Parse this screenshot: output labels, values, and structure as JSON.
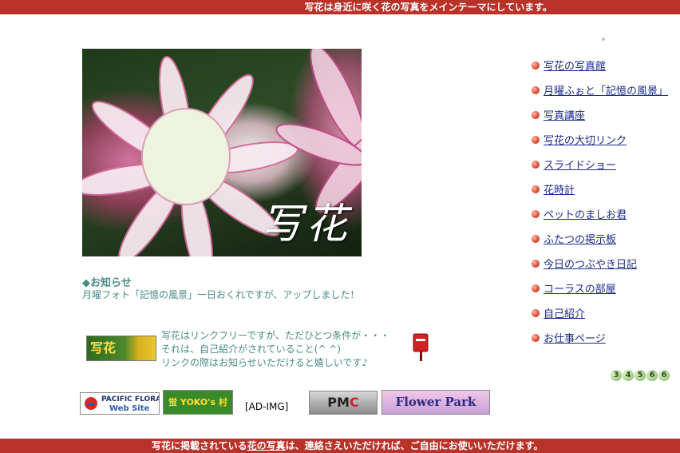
{
  "header": {
    "tagline": "写花は身近に咲く花の写真をメインテーマにしています。"
  },
  "top_mark": "。",
  "hero": {
    "caption": "写花"
  },
  "notice": {
    "title": "◆お知らせ",
    "text": "月曜フォト「記憶の風景」一日おくれですが、アップしました！"
  },
  "link_badge": {
    "label": "写花"
  },
  "link_free": {
    "line1": "写花はリンクフリーですが、ただひとつ条件が・・・",
    "line2": "それは、自己紹介がされていること(^ ^)",
    "line3": "リンクの際はお知らせいただけると嬉しいです♪"
  },
  "banners": {
    "pacific_top": "PACIFIC FLORA",
    "pacific_bottom": "Web Site",
    "yoko": "蛍 YOKO's 村",
    "ad": "[AD-IMG]",
    "pm": "PM",
    "pm_c": "C",
    "flower_park": "Flower Park"
  },
  "nav": {
    "items": [
      {
        "label": "写花の写真館"
      },
      {
        "label": "月曜ふぉと「記憶の風景」"
      },
      {
        "label": "写真講座"
      },
      {
        "label": "写花の大切リンク"
      },
      {
        "label": "スライドショー"
      },
      {
        "label": "花時計"
      },
      {
        "label": "ペットのましお君"
      },
      {
        "label": "ふたつの掲示板"
      },
      {
        "label": "今日のつぶやき日記"
      },
      {
        "label": "コーラスの部屋"
      },
      {
        "label": "自己紹介"
      },
      {
        "label": "お仕事ページ"
      }
    ]
  },
  "counter": {
    "digits": [
      "3",
      "4",
      "5",
      "6",
      "6"
    ]
  },
  "footer": {
    "part1": "写花に掲載されている",
    "part2": "花の写真",
    "part3": "は、連絡さえいただければ、ご自由にお使いいただけます。"
  },
  "colors": {
    "bar": "#b8322a",
    "notice_text": "#4a8a8a",
    "link": "#1a2a8a"
  }
}
